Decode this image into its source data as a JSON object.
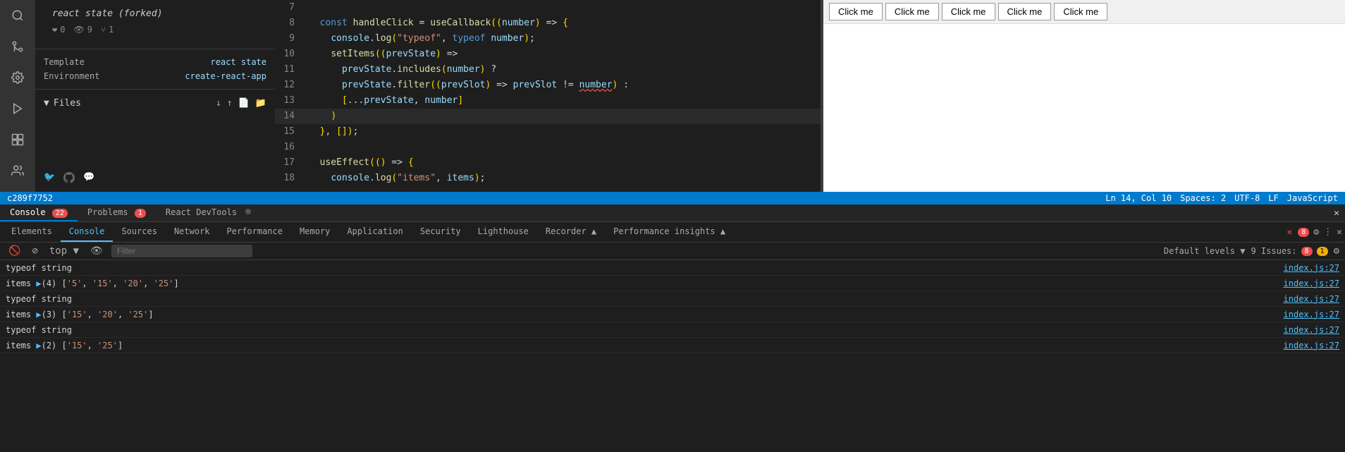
{
  "sidebar": {
    "icons": [
      "search",
      "git-branch",
      "settings",
      "run",
      "extensions",
      "users"
    ]
  },
  "file_panel": {
    "repo_title": "react state (forked)",
    "stats": [
      {
        "icon": "❤",
        "value": "0"
      },
      {
        "icon": "👁",
        "value": "9"
      },
      {
        "icon": "⑂",
        "value": "1"
      }
    ],
    "meta": [
      {
        "label": "Template",
        "value": "react state"
      },
      {
        "label": "Environment",
        "value": "create-react-app"
      }
    ],
    "files_header": "Files",
    "social": [
      "twitter",
      "github",
      "discord"
    ]
  },
  "code_editor": {
    "lines": [
      {
        "num": "7",
        "content": ""
      },
      {
        "num": "8",
        "content": "  const handleClick = useCallback((number) => {"
      },
      {
        "num": "9",
        "content": "    console.log(\"typeof\", typeof number);"
      },
      {
        "num": "10",
        "content": "    setItems((prevState) =>"
      },
      {
        "num": "11",
        "content": "      prevState.includes(number) ?"
      },
      {
        "num": "12",
        "content": "      prevState.filter((prevSlot) => prevSlot != number) :"
      },
      {
        "num": "13",
        "content": "      [...prevState, number]"
      },
      {
        "num": "14",
        "content": "    )"
      },
      {
        "num": "15",
        "content": "  }, []);"
      },
      {
        "num": "16",
        "content": ""
      },
      {
        "num": "17",
        "content": "  useEffect(() => {"
      },
      {
        "num": "18",
        "content": "    console.log(\"items\", items);"
      }
    ]
  },
  "status_bar": {
    "commit": "c289f7752",
    "ln_col": "Ln 14, Col 10",
    "spaces": "Spaces: 2",
    "encoding": "UTF-8",
    "eol": "LF",
    "language": "JavaScript"
  },
  "preview": {
    "buttons": [
      "Click me",
      "Click me",
      "Click me",
      "Click me",
      "Click me"
    ]
  },
  "devtools_top": {
    "tabs": [
      {
        "label": "Console",
        "badge": "22",
        "badge_type": "red"
      },
      {
        "label": "Problems",
        "badge": "1",
        "badge_type": "red"
      },
      {
        "label": "React DevTools",
        "badge": null
      }
    ]
  },
  "devtools_main": {
    "tabs": [
      {
        "label": "Elements",
        "active": false
      },
      {
        "label": "Console",
        "active": true
      },
      {
        "label": "Sources",
        "active": false
      },
      {
        "label": "Network",
        "active": false
      },
      {
        "label": "Performance",
        "active": false
      },
      {
        "label": "Memory",
        "active": false
      },
      {
        "label": "Application",
        "active": false
      },
      {
        "label": "Security",
        "active": false
      },
      {
        "label": "Lighthouse",
        "active": false
      },
      {
        "label": "Recorder ▲",
        "active": false
      },
      {
        "label": "Performance insights ▲",
        "active": false
      }
    ],
    "tabs_right": {
      "error_badge": "8",
      "more": "⋮",
      "close": "✕"
    }
  },
  "console_toolbar": {
    "filter_placeholder": "Filter",
    "default_levels": "Default levels ▼",
    "issues": "9 Issues:",
    "error_count": "8",
    "warn_count": "1"
  },
  "console_entries": [
    {
      "type": "text",
      "text": "typeof string",
      "link": "index.js:27"
    },
    {
      "type": "array",
      "text": "items ▶(4) ['5', '15', '20', '25']",
      "link": "index.js:27"
    },
    {
      "type": "text",
      "text": "typeof string",
      "link": "index.js:27"
    },
    {
      "type": "array",
      "text": "items ▶(3) ['15', '20', '25']",
      "link": "index.js:27"
    },
    {
      "type": "text",
      "text": "typeof string",
      "link": "index.js:27"
    },
    {
      "type": "array",
      "text": "items ▶(2) ['15', '25']",
      "link": "index.js:27"
    }
  ]
}
